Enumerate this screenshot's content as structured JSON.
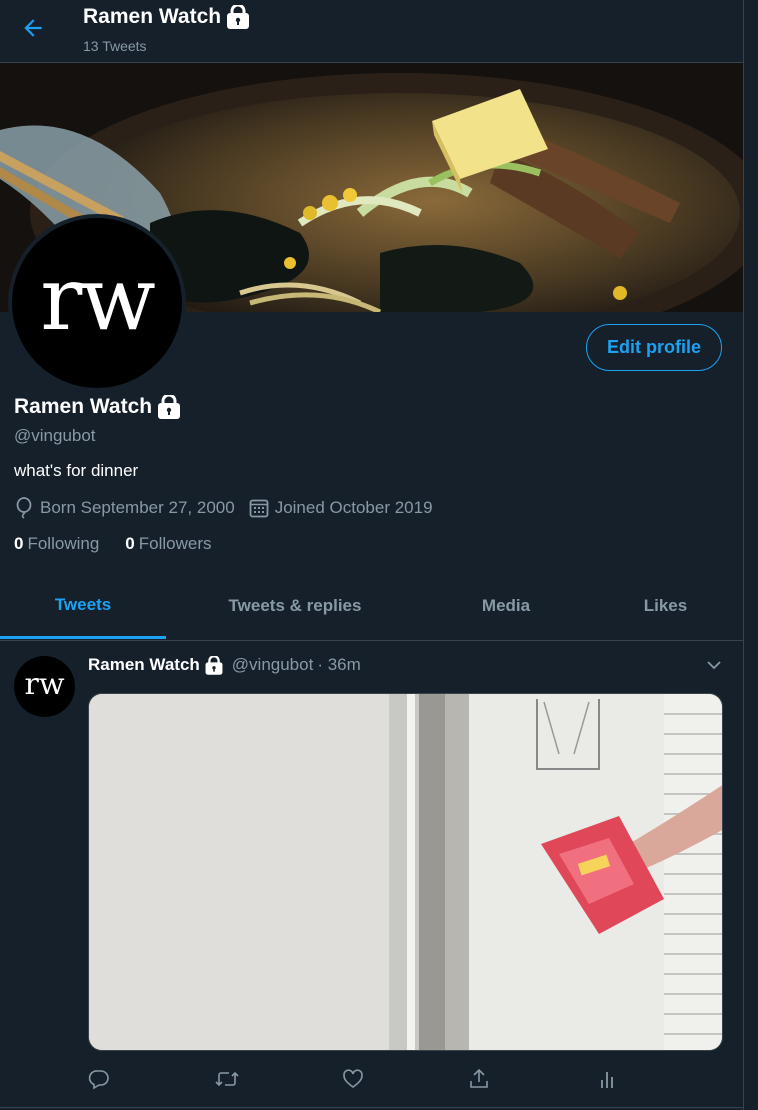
{
  "header": {
    "title": "Ramen Watch",
    "subtitle": "13 Tweets"
  },
  "profile": {
    "avatar_text": "rw",
    "edit_label": "Edit profile",
    "name": "Ramen Watch",
    "handle": "@vingubot",
    "bio": "what's for dinner",
    "born": "Born September 27, 2000",
    "joined": "Joined October 2019",
    "following_count": "0",
    "following_label": "Following",
    "followers_count": "0",
    "followers_label": "Followers"
  },
  "tabs": [
    {
      "label": "Tweets",
      "active": true
    },
    {
      "label": "Tweets & replies",
      "active": false
    },
    {
      "label": "Media",
      "active": false
    },
    {
      "label": "Likes",
      "active": false
    }
  ],
  "tweet": {
    "avatar_text": "rw",
    "name": "Ramen Watch",
    "handle": "@vingubot",
    "time": "· 36m"
  },
  "colors": {
    "background": "#15202b",
    "accent": "#1da1f2",
    "muted": "#8899a6",
    "border": "#38444d"
  },
  "icons": [
    "back-arrow-icon",
    "lock-icon",
    "balloon-icon",
    "calendar-icon",
    "chevron-down-icon",
    "reply-icon",
    "retweet-icon",
    "like-icon",
    "share-icon",
    "analytics-icon"
  ]
}
